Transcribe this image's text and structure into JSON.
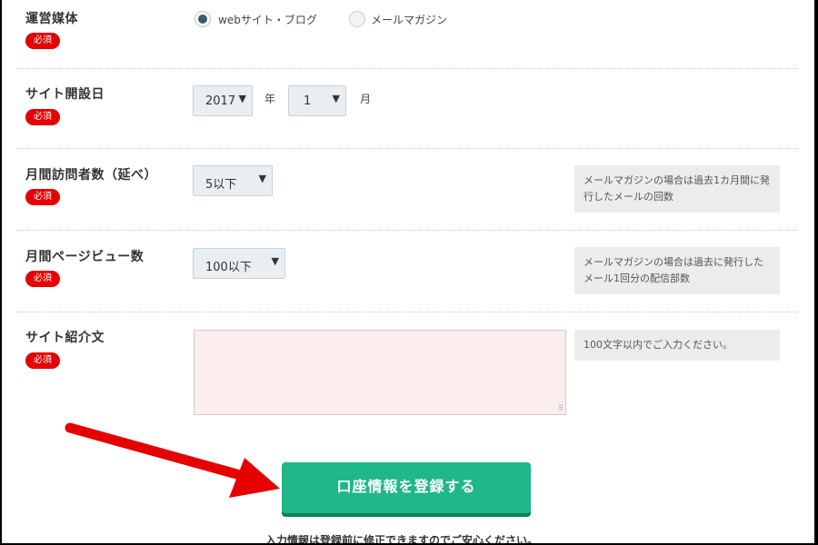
{
  "required_label": "必須",
  "media": {
    "label": "運営媒体",
    "options": [
      {
        "label": "webサイト・ブログ",
        "checked": true
      },
      {
        "label": "メールマガジン",
        "checked": false
      }
    ]
  },
  "opened": {
    "label": "サイト開設日",
    "year": "2017",
    "year_unit": "年",
    "month": "1",
    "month_unit": "月"
  },
  "visitors": {
    "label": "月間訪問者数（延べ）",
    "value": "5以下",
    "hint": "メールマガジンの場合は過去1カ月間に発行したメールの回数"
  },
  "pageviews": {
    "label": "月間ページビュー数",
    "value": "100以下",
    "hint": "メールマガジンの場合は過去に発行したメール1回分の配信部数"
  },
  "intro": {
    "label": "サイト紹介文",
    "value": "",
    "hint": "100文字以内でご入力ください。"
  },
  "submit_label": "口座情報を登録する",
  "footer_note": "入力情報は登録前に修正できますのでご安心ください。",
  "icons": {
    "dropdown": "▼",
    "resize": "⠿"
  },
  "colors": {
    "accent": "#1fb888",
    "required_badge": "#e60000",
    "arrow": "#e60000"
  }
}
